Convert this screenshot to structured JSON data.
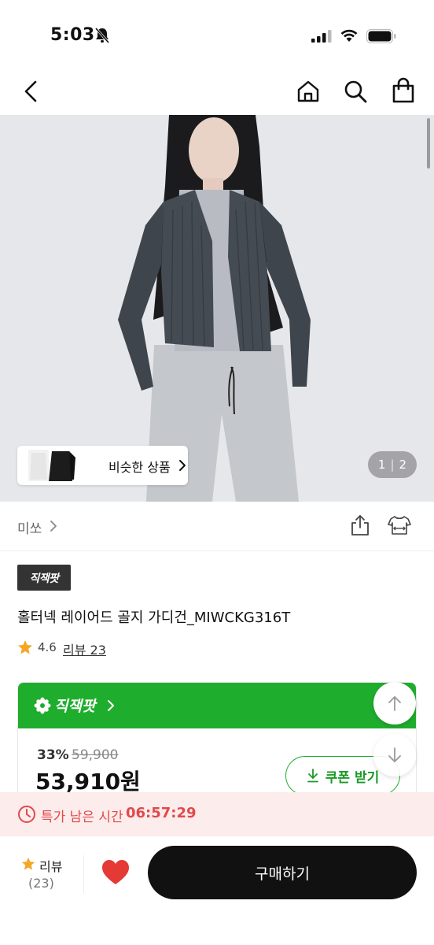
{
  "status_bar": {
    "time": "5:03"
  },
  "icons": {
    "back": "chevron-left-icon",
    "home": "home-icon",
    "search": "search-icon",
    "bag": "shopping-bag-icon",
    "share": "share-icon",
    "fit": "size-fit-icon",
    "star": "star-icon",
    "clock": "clock-icon",
    "heart": "heart-icon",
    "coupon_download": "download-arrow-icon",
    "scroll_up": "arrow-up-icon",
    "scroll_down": "arrow-down-icon"
  },
  "gallery": {
    "similar_label": "비슷한 상품",
    "current_index": "1",
    "total": "2"
  },
  "brand": {
    "name": "미쏘"
  },
  "product": {
    "badge": "직잭팟",
    "title": "홀터넥 레이어드 골지 가디건_MIWCKG316T",
    "rating": "4.6",
    "review_link": "리뷰 23"
  },
  "deal_card": {
    "logo_text": "직잭팟",
    "discount_rate": "33%",
    "original_price": "59,900",
    "sale_price": "53,910원",
    "coupon_label": "쿠폰 받기"
  },
  "timer": {
    "label": "특가 남은 시간",
    "remaining": "06:57:29"
  },
  "bottom_bar": {
    "review_label": "리뷰",
    "review_count": "(23)",
    "buy_label": "구매하기"
  },
  "colors": {
    "accent_green": "#1fad2d",
    "timer_red": "#e04a4a",
    "heart_red": "#e53935",
    "star_orange": "#f5a623",
    "buy_button": "#111111"
  }
}
